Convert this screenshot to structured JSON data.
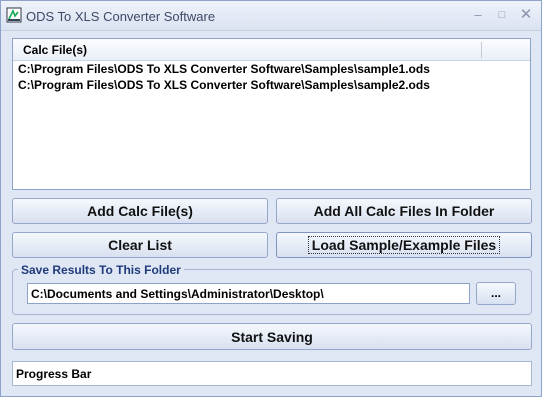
{
  "window": {
    "title": "ODS To XLS Converter Software",
    "controls": {
      "minimize": "–",
      "maximize": "□",
      "close": "✕"
    }
  },
  "file_list": {
    "column_header": "Calc File(s)",
    "rows": [
      "C:\\Program Files\\ODS To XLS Converter Software\\Samples\\sample1.ods",
      "C:\\Program Files\\ODS To XLS Converter Software\\Samples\\sample2.ods"
    ]
  },
  "buttons": {
    "add": "Add Calc File(s)",
    "add_all": "Add All Calc Files In Folder",
    "clear": "Clear List",
    "load_samples": "Load Sample/Example Files",
    "browse": "...",
    "start": "Start Saving"
  },
  "output": {
    "group_label": "Save Results To This Folder",
    "folder_path": "C:\\Documents and Settings\\Administrator\\Desktop\\"
  },
  "progress": {
    "label": "Progress Bar",
    "value": 0
  },
  "icons": {
    "app": "app-icon"
  }
}
